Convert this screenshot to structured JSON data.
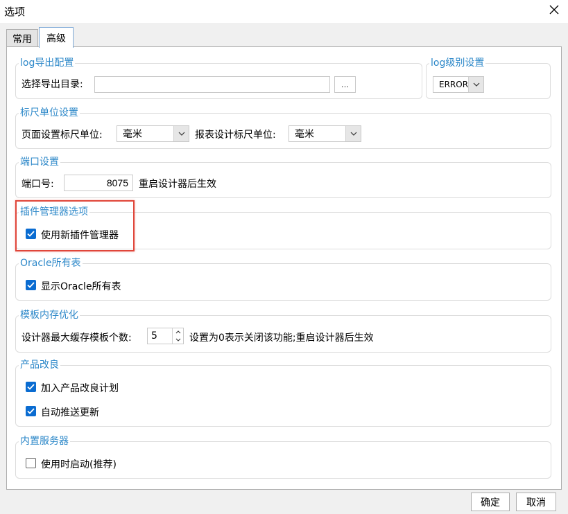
{
  "window": {
    "title": "选项"
  },
  "tabs": [
    {
      "label": "常用"
    },
    {
      "label": "高级"
    }
  ],
  "log_export": {
    "title": "log导出配置",
    "dir_label": "选择导出目录:",
    "dir_value": "",
    "browse_label": "..."
  },
  "log_level": {
    "title": "log级别设置",
    "value": "ERROR"
  },
  "ruler": {
    "title": "标尺单位设置",
    "page_label": "页面设置标尺单位:",
    "page_value": "毫米",
    "report_label": "报表设计标尺单位:",
    "report_value": "毫米"
  },
  "port": {
    "title": "端口设置",
    "label": "端口号:",
    "value": "8075",
    "note": "重启设计器后生效"
  },
  "plugin": {
    "title": "插件管理器选项",
    "use_new_label": "使用新插件管理器",
    "use_new_checked": true
  },
  "oracle": {
    "title": "Oracle所有表",
    "show_all_label": "显示Oracle所有表",
    "show_all_checked": true
  },
  "template_memory": {
    "title": "模板内存优化",
    "max_cache_label": "设计器最大缓存模板个数:",
    "max_cache_value": "5",
    "note": "设置为0表示关闭该功能;重启设计器后生效"
  },
  "improvement": {
    "title": "产品改良",
    "join_label": "加入产品改良计划",
    "join_checked": true,
    "auto_update_label": "自动推送更新",
    "auto_update_checked": true
  },
  "builtin_server": {
    "title": "内置服务器",
    "start_on_use_label": "使用时启动(推荐)",
    "start_on_use_checked": false
  },
  "buttons": {
    "ok": "确定",
    "cancel": "取消"
  },
  "colors": {
    "accent": "#2d88c9",
    "check": "#0a6cd1",
    "highlight": "#e0463a"
  }
}
